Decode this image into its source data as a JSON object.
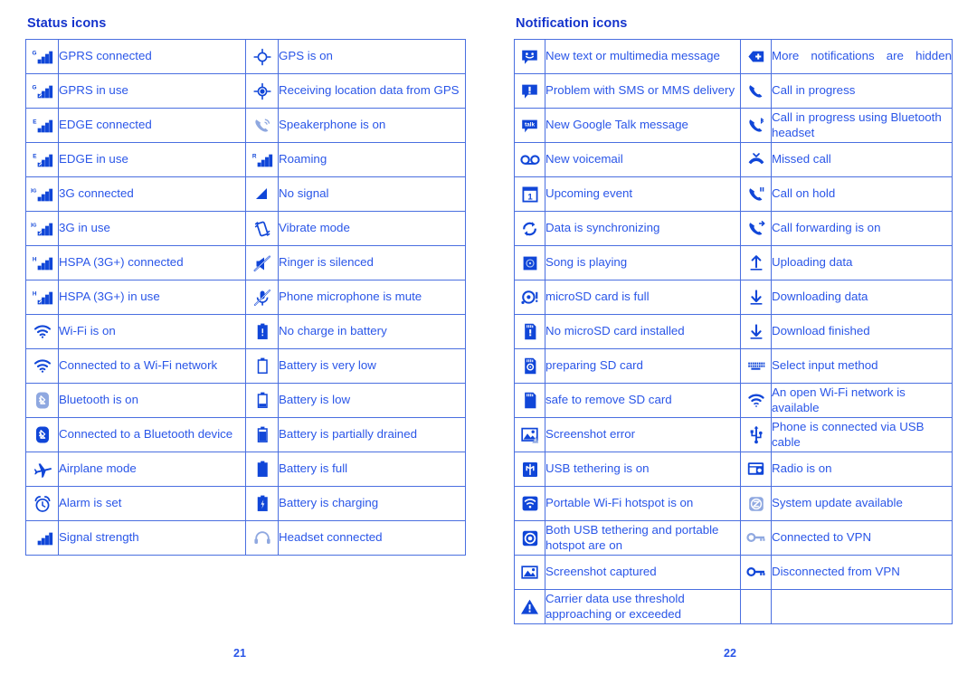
{
  "status_section": {
    "title": "Status icons",
    "rows": [
      [
        {
          "icon": "signal-gprs-connected-icon",
          "label": "GPRS connected"
        },
        {
          "icon": "gps-on-icon",
          "label": "GPS is on"
        }
      ],
      [
        {
          "icon": "signal-gprs-in-use-icon",
          "label": "GPRS in use"
        },
        {
          "icon": "gps-receiving-location-icon",
          "label": "Receiving location data from GPS"
        }
      ],
      [
        {
          "icon": "signal-edge-connected-icon",
          "label": "EDGE connected"
        },
        {
          "icon": "speakerphone-on-icon",
          "label": "Speakerphone is on"
        }
      ],
      [
        {
          "icon": "signal-edge-in-use-icon",
          "label": "EDGE in use"
        },
        {
          "icon": "signal-roaming-icon",
          "label": "Roaming"
        }
      ],
      [
        {
          "icon": "signal-3g-connected-icon",
          "label": "3G connected"
        },
        {
          "icon": "no-signal-icon",
          "label": "No signal"
        }
      ],
      [
        {
          "icon": "signal-3g-in-use-icon",
          "label": "3G in use"
        },
        {
          "icon": "vibrate-mode-icon",
          "label": "Vibrate mode"
        }
      ],
      [
        {
          "icon": "signal-hspa-connected-icon",
          "label": "HSPA (3G+) connected"
        },
        {
          "icon": "ringer-silenced-icon",
          "label": "Ringer is silenced"
        }
      ],
      [
        {
          "icon": "signal-hspa-in-use-icon",
          "label": "HSPA (3G+) in use"
        },
        {
          "icon": "microphone-mute-icon",
          "label": "Phone microphone is mute"
        }
      ],
      [
        {
          "icon": "wifi-on-icon",
          "label": "Wi-Fi is on"
        },
        {
          "icon": "battery-no-charge-icon",
          "label": "No charge in battery"
        }
      ],
      [
        {
          "icon": "wifi-connected-icon",
          "label": "Connected to a Wi-Fi network"
        },
        {
          "icon": "battery-very-low-icon",
          "label": "Battery is very low"
        }
      ],
      [
        {
          "icon": "bluetooth-on-icon",
          "label": "Bluetooth is on"
        },
        {
          "icon": "battery-low-icon",
          "label": "Battery is low"
        }
      ],
      [
        {
          "icon": "bluetooth-connected-icon",
          "label": "Connected to a Bluetooth device"
        },
        {
          "icon": "battery-partially-drained-icon",
          "label": "Battery is partially drained"
        }
      ],
      [
        {
          "icon": "airplane-mode-icon",
          "label": "Airplane mode"
        },
        {
          "icon": "battery-full-icon",
          "label": "Battery is full"
        }
      ],
      [
        {
          "icon": "alarm-set-icon",
          "label": "Alarm is set"
        },
        {
          "icon": "battery-charging-icon",
          "label": "Battery is charging"
        }
      ],
      [
        {
          "icon": "signal-strength-icon",
          "label": "Signal strength"
        },
        {
          "icon": "headset-connected-icon",
          "label": "Headset connected"
        }
      ]
    ]
  },
  "notification_section": {
    "title": "Notification icons",
    "rows": [
      [
        {
          "icon": "new-message-icon",
          "label": "New text or multimedia message"
        },
        {
          "icon": "more-notifications-icon",
          "label": "More notifications are hidden",
          "justify": true
        }
      ],
      [
        {
          "icon": "message-problem-icon",
          "label": "Problem with SMS or MMS delivery"
        },
        {
          "icon": "call-in-progress-icon",
          "label": "Call in progress"
        }
      ],
      [
        {
          "icon": "google-talk-message-icon",
          "label": "New Google Talk message"
        },
        {
          "icon": "call-bluetooth-icon",
          "label": "Call in progress using Bluetooth headset"
        }
      ],
      [
        {
          "icon": "voicemail-icon",
          "label": "New voicemail"
        },
        {
          "icon": "missed-call-icon",
          "label": "Missed call"
        }
      ],
      [
        {
          "icon": "upcoming-event-icon",
          "label": "Upcoming event"
        },
        {
          "icon": "call-on-hold-icon",
          "label": "Call on hold"
        }
      ],
      [
        {
          "icon": "data-sync-icon",
          "label": "Data is synchronizing"
        },
        {
          "icon": "call-forwarding-icon",
          "label": "Call forwarding is on"
        }
      ],
      [
        {
          "icon": "song-playing-icon",
          "label": "Song is playing"
        },
        {
          "icon": "uploading-data-icon",
          "label": "Uploading data"
        }
      ],
      [
        {
          "icon": "microsd-full-icon",
          "label": "microSD card is full"
        },
        {
          "icon": "downloading-data-icon",
          "label": "Downloading data"
        }
      ],
      [
        {
          "icon": "no-microsd-icon",
          "label": "No microSD card installed"
        },
        {
          "icon": "download-finished-icon",
          "label": "Download finished"
        }
      ],
      [
        {
          "icon": "preparing-sd-card-icon",
          "label": "preparing SD card"
        },
        {
          "icon": "select-input-method-icon",
          "label": "Select input method"
        }
      ],
      [
        {
          "icon": "safe-remove-sd-icon",
          "label": "safe to remove SD card"
        },
        {
          "icon": "open-wifi-available-icon",
          "label": "An open Wi-Fi network is available"
        }
      ],
      [
        {
          "icon": "screenshot-error-icon",
          "label": "Screenshot error"
        },
        {
          "icon": "usb-connected-icon",
          "label": "Phone is connected via USB cable"
        }
      ],
      [
        {
          "icon": "usb-tethering-icon",
          "label": "USB tethering is on"
        },
        {
          "icon": "radio-on-icon",
          "label": "Radio is on"
        }
      ],
      [
        {
          "icon": "portable-hotspot-icon",
          "label": "Portable Wi-Fi hotspot is on"
        },
        {
          "icon": "system-update-icon",
          "label": "System update available"
        }
      ],
      [
        {
          "icon": "tethering-and-hotspot-icon",
          "label": "Both USB tethering and portable hotspot are on"
        },
        {
          "icon": "vpn-connected-icon",
          "label": "Connected to VPN"
        }
      ],
      [
        {
          "icon": "screenshot-captured-icon",
          "label": "Screenshot captured"
        },
        {
          "icon": "vpn-disconnected-icon",
          "label": "Disconnected from VPN"
        }
      ],
      [
        {
          "icon": "carrier-data-warning-icon",
          "label": "Carrier data use threshold approaching or exceeded"
        },
        {
          "icon": "",
          "label": ""
        }
      ]
    ]
  },
  "footer": {
    "page_left": "21",
    "page_right": "22"
  },
  "colors": {
    "heading": "#1433cc",
    "text": "#2a56e8",
    "border": "#4a6fe0",
    "icon": "#1046d8",
    "icon_muted": "#8fa8e0"
  }
}
